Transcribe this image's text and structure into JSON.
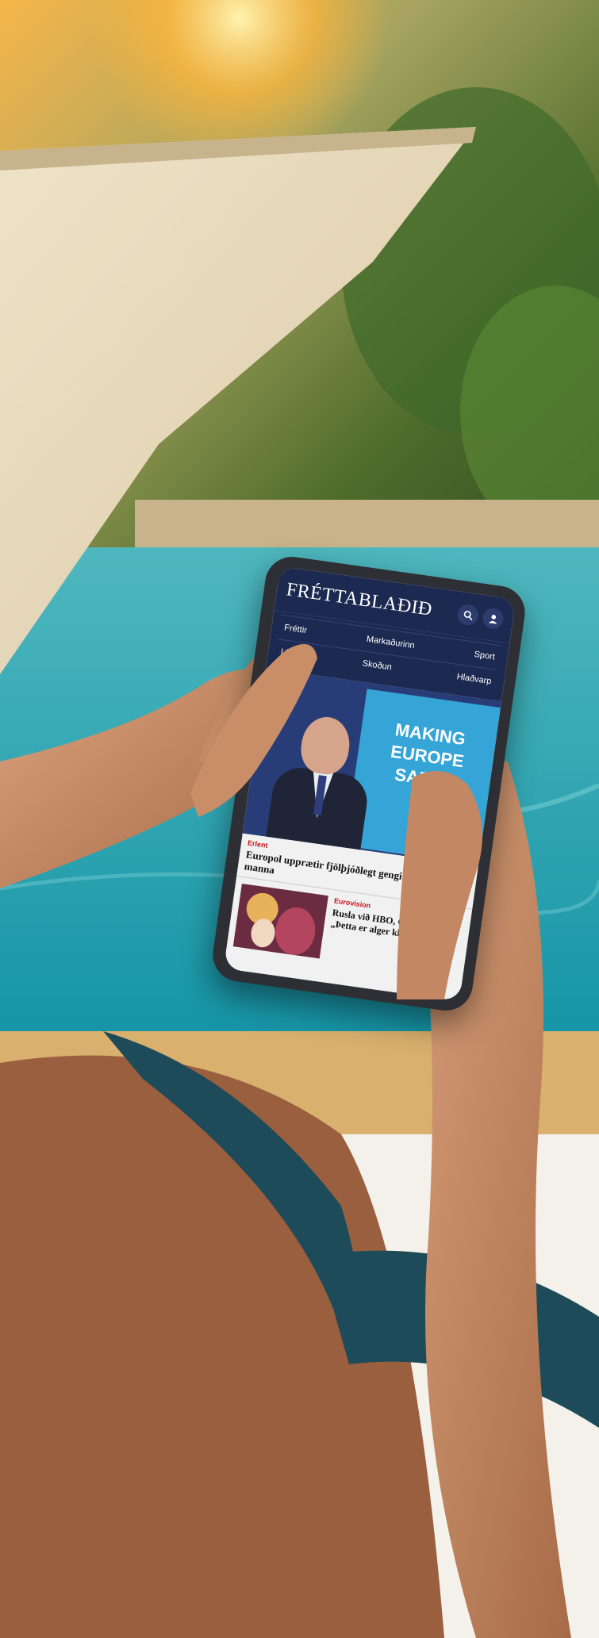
{
  "app": {
    "logo": "FRÉTTABLAÐIÐ",
    "search_icon": "search-icon",
    "user_icon": "user-icon"
  },
  "nav": {
    "row1": [
      "Fréttir",
      "Markaðurinn",
      "Sport"
    ],
    "row2": [
      "Lífið",
      "Skoðun",
      "Hlaðvarp"
    ]
  },
  "hero": {
    "image_text": "MAKING EUROPE SAFER",
    "tag": "Erlent",
    "headline": "Europol upprætir fjölþjóðlegt gengi netglæpa-manna"
  },
  "story2": {
    "tag": "Eurovision",
    "headline": "Rusla við HBO, CNN og BBC: „Þetta er alger klikkun“"
  },
  "colors": {
    "masthead": "#1c2951",
    "accent_red": "#c6141c",
    "pool": "#1aa7b3"
  }
}
